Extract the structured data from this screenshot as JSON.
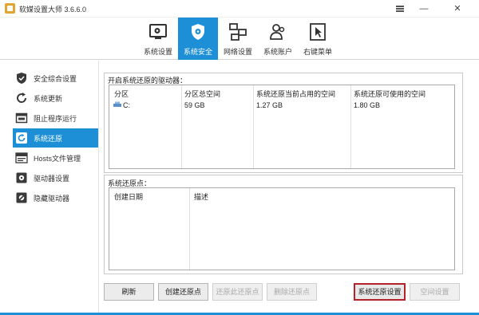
{
  "window": {
    "title": "软媒设置大师 3.6.6.0",
    "minimize_symbol": "—",
    "close_symbol": "✕"
  },
  "toolbar": {
    "tabs": [
      {
        "label": "系统设置",
        "icon": "system-settings-icon"
      },
      {
        "label": "系统安全",
        "icon": "shield-icon",
        "active": true
      },
      {
        "label": "网络设置",
        "icon": "network-icon"
      },
      {
        "label": "系统账户",
        "icon": "users-icon"
      },
      {
        "label": "右键菜单",
        "icon": "cursor-icon"
      }
    ]
  },
  "sidebar": {
    "items": [
      {
        "label": "安全综合设置",
        "icon": "shield-check-icon"
      },
      {
        "label": "系统更新",
        "icon": "refresh-icon"
      },
      {
        "label": "阻止程序运行",
        "icon": "block-window-icon"
      },
      {
        "label": "系统还原",
        "icon": "restore-icon",
        "active": true
      },
      {
        "label": "Hosts文件管理",
        "icon": "hosts-file-icon"
      },
      {
        "label": "驱动器设置",
        "icon": "drive-settings-icon"
      },
      {
        "label": "隐藏驱动器",
        "icon": "hidden-drive-icon"
      }
    ]
  },
  "drives": {
    "section_label": "开启系统还原的驱动器：",
    "columns": [
      "分区",
      "分区总空间",
      "系统还原当前占用的空间",
      "系统还原可使用的空间"
    ],
    "rows": [
      {
        "partition": "C:",
        "total": "59 GB",
        "used": "1.27 GB",
        "available": "1.80 GB"
      }
    ]
  },
  "restore_points": {
    "section_label": "系统还原点：",
    "columns": [
      "创建日期",
      "描述"
    ],
    "rows": []
  },
  "buttons": {
    "refresh": "刷新",
    "create": "创建还原点",
    "restore": "还原此还原点",
    "delete": "删除还原点",
    "settings": "系统还原设置",
    "space": "空间设置"
  },
  "colors": {
    "accent": "#1c8fd6",
    "highlight_border": "#b4222a"
  }
}
